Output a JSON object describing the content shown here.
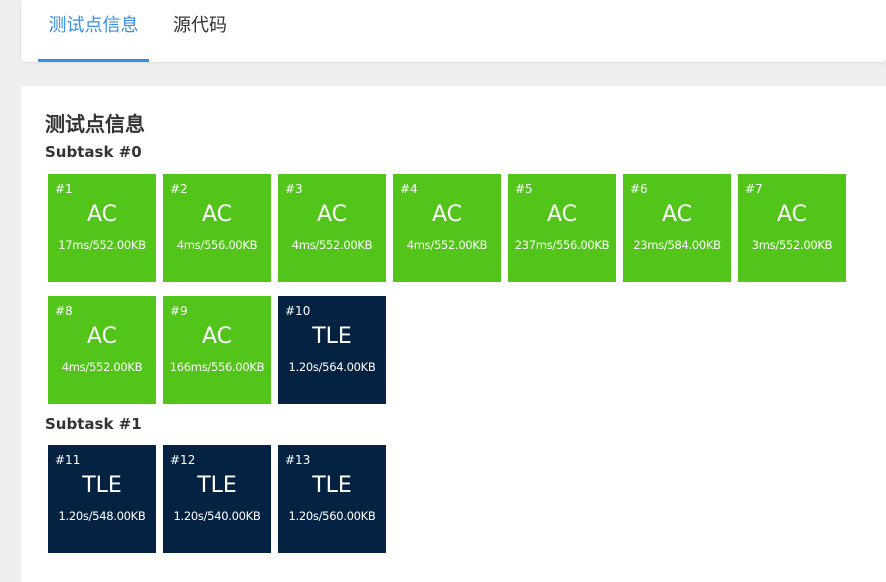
{
  "tabs": [
    {
      "label": "测试点信息",
      "active": true
    },
    {
      "label": "源代码",
      "active": false
    }
  ],
  "section_title": "测试点信息",
  "colors": {
    "accent": "#3a8ee6",
    "ac": "#52c41a",
    "tle": "#052242"
  },
  "subtasks": [
    {
      "title": "Subtask #0",
      "cases": [
        {
          "num": "#1",
          "status": "AC",
          "stats": "17ms/552.00KB"
        },
        {
          "num": "#2",
          "status": "AC",
          "stats": "4ms/556.00KB"
        },
        {
          "num": "#3",
          "status": "AC",
          "stats": "4ms/552.00KB"
        },
        {
          "num": "#4",
          "status": "AC",
          "stats": "4ms/552.00KB"
        },
        {
          "num": "#5",
          "status": "AC",
          "stats": "237ms/556.00KB"
        },
        {
          "num": "#6",
          "status": "AC",
          "stats": "23ms/584.00KB"
        },
        {
          "num": "#7",
          "status": "AC",
          "stats": "3ms/552.00KB"
        },
        {
          "num": "#8",
          "status": "AC",
          "stats": "4ms/552.00KB"
        },
        {
          "num": "#9",
          "status": "AC",
          "stats": "166ms/556.00KB"
        },
        {
          "num": "#10",
          "status": "TLE",
          "stats": "1.20s/564.00KB"
        }
      ]
    },
    {
      "title": "Subtask #1",
      "cases": [
        {
          "num": "#11",
          "status": "TLE",
          "stats": "1.20s/548.00KB"
        },
        {
          "num": "#12",
          "status": "TLE",
          "stats": "1.20s/540.00KB"
        },
        {
          "num": "#13",
          "status": "TLE",
          "stats": "1.20s/560.00KB"
        }
      ]
    }
  ]
}
